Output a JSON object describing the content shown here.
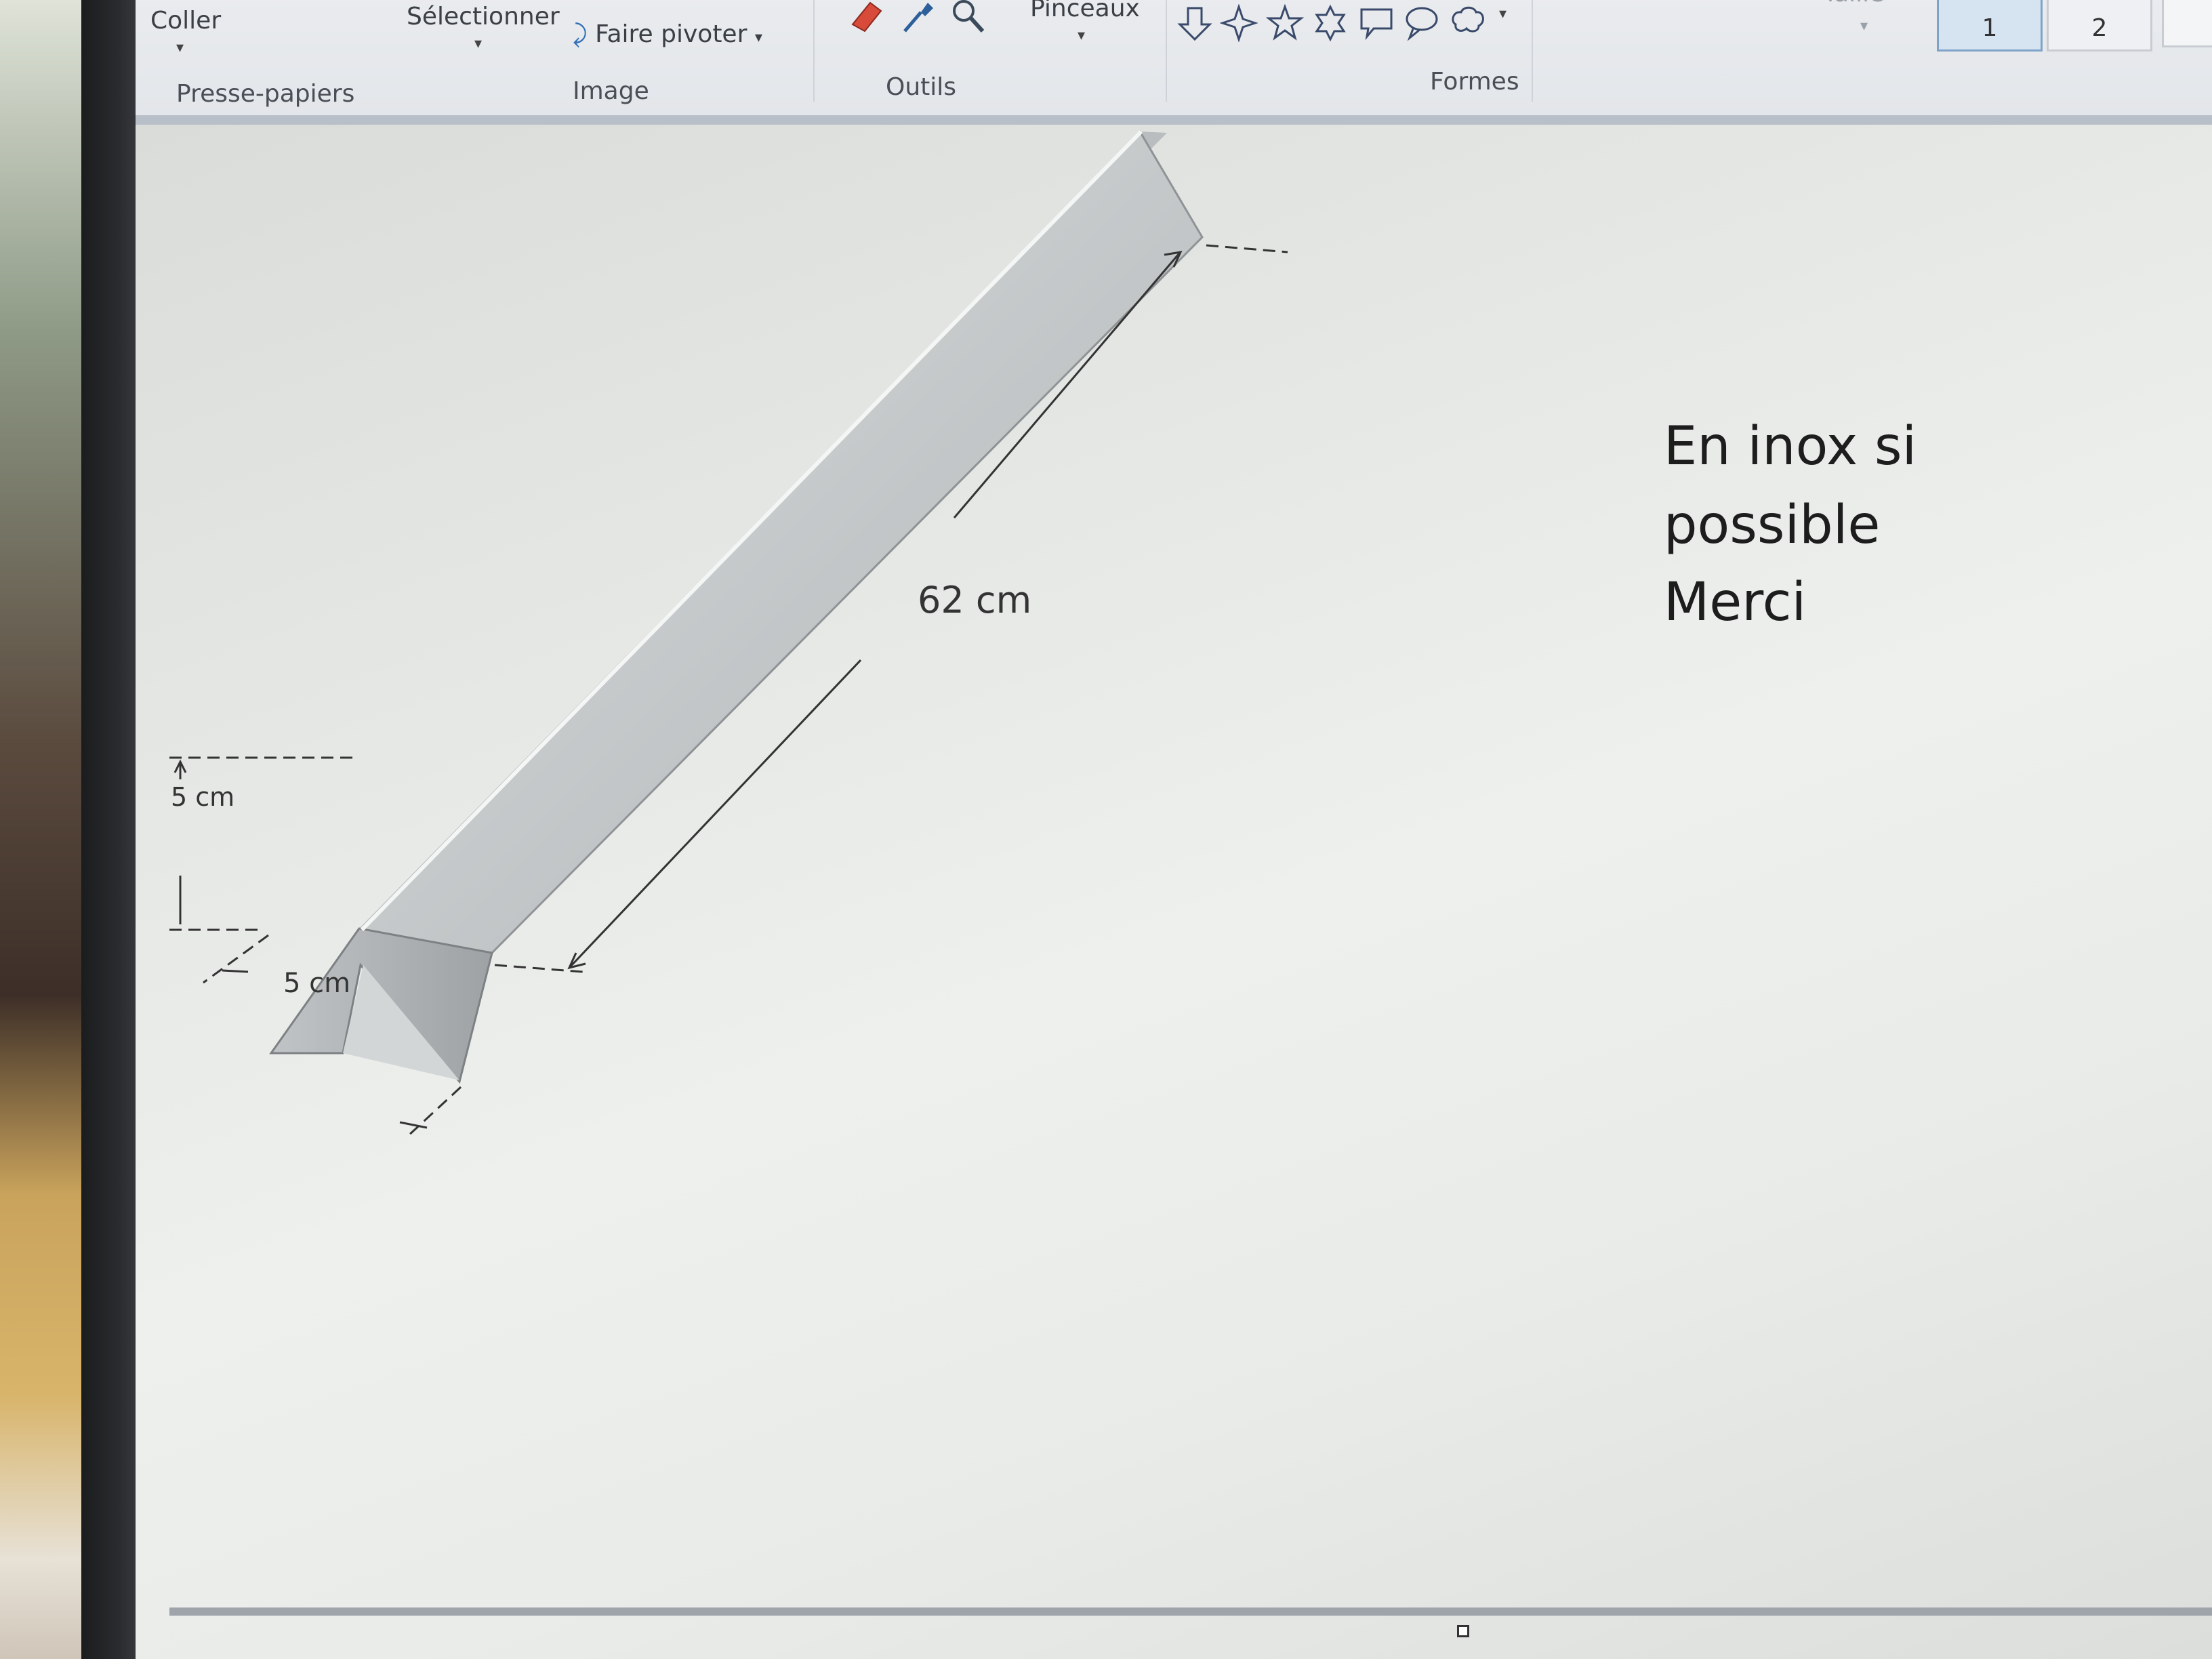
{
  "ribbon": {
    "coller_label": "Coller",
    "selectionner_label": "Sélectionner",
    "faire_pivoter_label": "Faire pivoter",
    "pinceaux_label": "Pinceaux",
    "taille_label": "Taille",
    "couleur1_number": "1",
    "couleur2_number": "2",
    "groups": {
      "presse_papiers": "Presse-papiers",
      "image": "Image",
      "outils": "Outils",
      "formes": "Formes"
    }
  },
  "drawing": {
    "length_label": "62 cm",
    "height_label": "5 cm",
    "width_label": "5 cm"
  },
  "note": {
    "line1": "En inox si",
    "line2": "possible",
    "line3": "Merci"
  },
  "colors": {
    "color1_box": "#d6e4f2",
    "prism_light": "#d2d5d6",
    "prism_dark": "#a9adaf"
  }
}
